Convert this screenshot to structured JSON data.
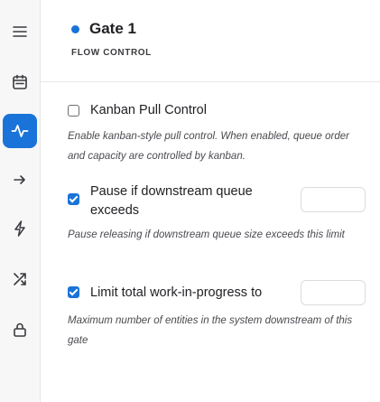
{
  "toolbar": {
    "items": [
      {
        "icon": "menu-icon",
        "active": false
      },
      {
        "icon": "calendar-icon",
        "active": false
      },
      {
        "icon": "activity-icon",
        "active": true
      },
      {
        "icon": "arrow-right-icon",
        "active": false
      },
      {
        "icon": "merge-arrows-icon",
        "active": false
      },
      {
        "icon": "lightning-icon",
        "active": false
      },
      {
        "icon": "shuffle-icon",
        "active": false
      },
      {
        "icon": "lock-icon",
        "active": false
      }
    ]
  },
  "header": {
    "title": "Gate 1",
    "subtitle": "FLOW CONTROL",
    "dot_color": "#1a73d9"
  },
  "options": {
    "kanban": {
      "label": "Kanban Pull Control",
      "checked": false,
      "description": "Enable kanban-style pull control. When enabled, queue order and capacity are controlled by kanban."
    },
    "pause": {
      "label_line1": "Pause if downstream queue",
      "label_line2": "exceeds",
      "checked": true,
      "value": "",
      "description": "Pause releasing if downstream queue size exceeds this limit"
    },
    "wip": {
      "label": "Limit total work-in-progress to",
      "checked": true,
      "value": "",
      "description": "Maximum number of entities in the system downstream of this gate"
    }
  },
  "colors": {
    "accent": "#1a73d9"
  }
}
